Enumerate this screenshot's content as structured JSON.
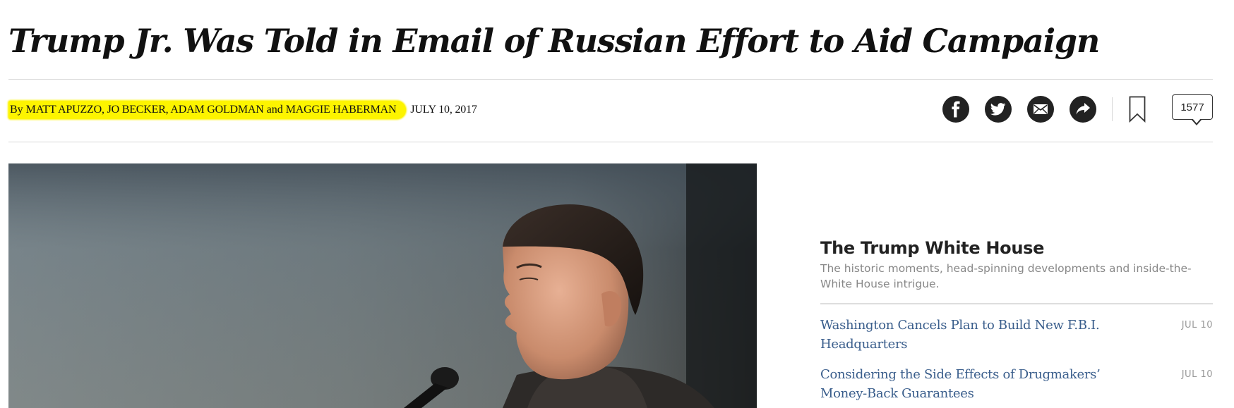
{
  "article": {
    "headline": "Trump Jr. Was Told in Email of Russian Effort to Aid Campaign",
    "byline_prefix": "By",
    "byline_authors": "MATT APUZZO, JO BECKER, ADAM GOLDMAN",
    "byline_and": "and",
    "byline_last_author": "MAGGIE HABERMAN",
    "date": "JULY 10, 2017",
    "highlight_color": "#fdf400"
  },
  "toolbar": {
    "share_icons": [
      "facebook-icon",
      "twitter-icon",
      "email-icon",
      "share-arrow-icon"
    ],
    "bookmark_icon": "bookmark-icon",
    "comment_count": "1577"
  },
  "rail": {
    "title": "The Trump White House",
    "description": "The historic moments, head-spinning developments and inside-the-White House intrigue.",
    "items": [
      {
        "title": "Washington Cancels Plan to Build New F.B.I. Headquarters",
        "date": "JUL 10"
      },
      {
        "title": "Considering the Side Effects of Drugmakers’ Money-Back Guarantees",
        "date": "JUL 10"
      }
    ],
    "link_color": "#3a5e8c"
  }
}
